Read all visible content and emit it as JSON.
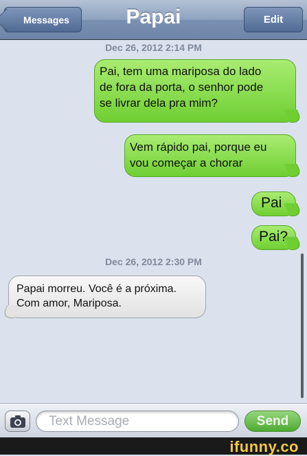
{
  "navbar": {
    "back_label": "Messages",
    "title": "Papai",
    "edit_label": "Edit"
  },
  "timestamps": [
    "Dec 26, 2012 2:14 PM",
    "Dec 26, 2012 2:30 PM"
  ],
  "messages": [
    {
      "sender": "me",
      "lines": [
        "Pai, tem uma mariposa do lado",
        "de fora da porta, o senhor pode",
        "se livrar dela pra mim?"
      ]
    },
    {
      "sender": "me",
      "lines": [
        "Vem rápido pai, porque eu",
        "vou começar a chorar"
      ]
    },
    {
      "sender": "me",
      "lines": [
        "Pai"
      ]
    },
    {
      "sender": "me",
      "lines": [
        "Pai?"
      ]
    },
    {
      "sender": "them",
      "lines": [
        "Papai morreu. Você é a próxima.",
        "Com amor, Mariposa."
      ]
    }
  ],
  "input": {
    "placeholder": "Text Message",
    "send_label": "Send"
  },
  "watermark": "ifunny.co",
  "colors": {
    "outgoing": "#7fd84a",
    "incoming": "#ececec",
    "navbar": "#8da2bf"
  },
  "icons": [
    "camera-icon"
  ]
}
